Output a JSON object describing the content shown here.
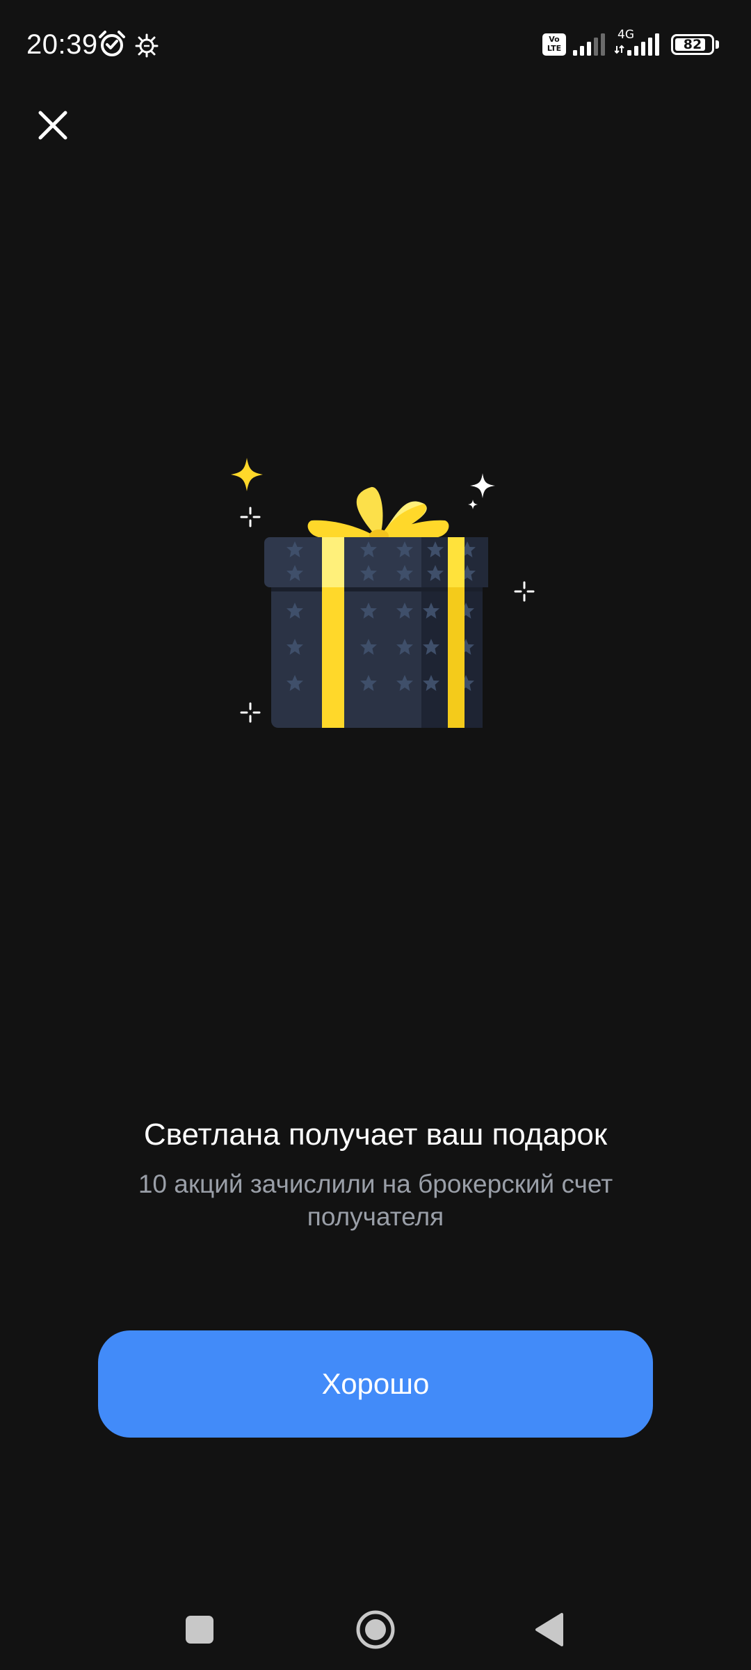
{
  "status_bar": {
    "time": "20:39",
    "icons": [
      "alarm-icon",
      "gear-notification-icon",
      "volte-icon",
      "signal-icon",
      "signal-4g-icon",
      "battery-icon"
    ],
    "volte_label": "Vo\nLTE",
    "network_label": "4G",
    "battery_level": "82"
  },
  "header": {
    "close_icon": "close-icon"
  },
  "illustration": {
    "name": "gift-box-illustration",
    "colors": {
      "box": "#2b3345",
      "stars": "#3f4f6a",
      "ribbon": "#ffd82a",
      "ribbon_light": "#fff07a",
      "sparkle_gold": "#ffd82a",
      "sparkle_white": "#ffffff"
    }
  },
  "message": {
    "title": "Светлана получает ваш подарок",
    "subtitle": "10 акций зачислили на брокерский счет получателя"
  },
  "actions": {
    "ok_label": "Хорошо"
  },
  "colors": {
    "background": "#121212",
    "primary": "#428bf9",
    "subtitle_text": "#9a9fa8"
  },
  "nav_bar": {
    "items": [
      "recents-icon",
      "home-icon",
      "back-icon"
    ]
  }
}
